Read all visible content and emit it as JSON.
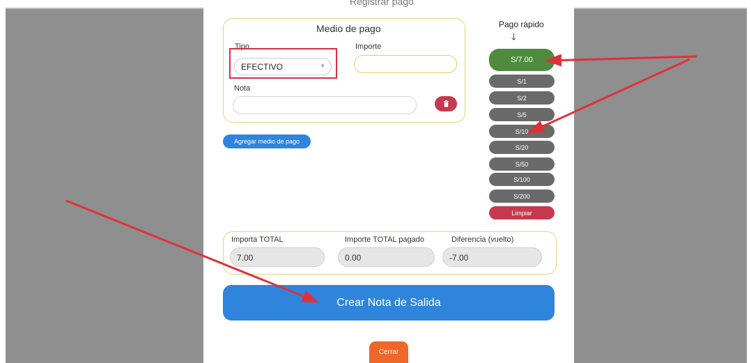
{
  "modal": {
    "title_partial": "Registrar pago"
  },
  "payment": {
    "title": "Medio de pago",
    "tipo_label": "Tipo",
    "tipo_value": "EFECTIVO",
    "importe_label": "Importe",
    "importe_value": "",
    "nota_label": "Nota",
    "nota_value": "",
    "add_button": "Agregar medio de pago"
  },
  "quick_pay": {
    "title": "Pago rápido",
    "main": "S/7.00",
    "amounts": [
      "S/1",
      "S/2",
      "S/5",
      "S/10",
      "S/20",
      "S/50",
      "S/100",
      "S/200"
    ],
    "clear": "Limpiar"
  },
  "totals": {
    "total_label": "Importa TOTAL",
    "total_value": "7.00",
    "paid_label": "Importe TOTAL pagado",
    "paid_value": "0.00",
    "diff_label": "Diferencia (vuelto)",
    "diff_value": "-7.00"
  },
  "actions": {
    "create": "Crear Nota de Salida",
    "close": "Cerrar"
  },
  "colors": {
    "annotation": "#e0303a",
    "primary": "#2f85dc",
    "quick_main": "#4e8b3e",
    "danger": "#c53a4f",
    "close": "#f0672a"
  },
  "icons": {
    "trash": "trash-icon",
    "arrow_down": "arrow-down-icon"
  }
}
